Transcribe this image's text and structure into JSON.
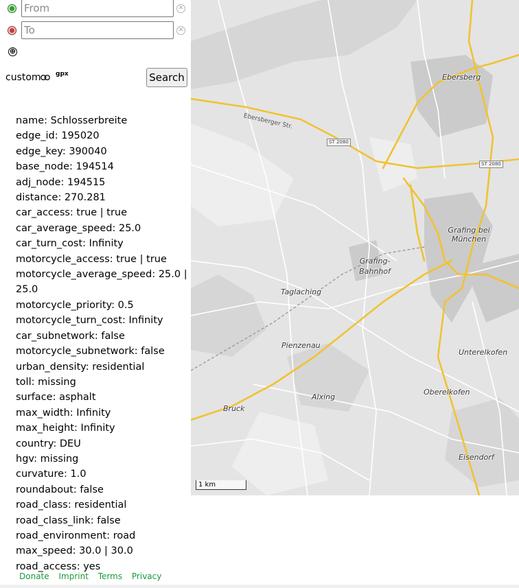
{
  "route": {
    "from_placeholder": "From",
    "to_placeholder": "To",
    "add_point_symbol": "⊕",
    "clear_symbol": "✕",
    "custom_label": "custom",
    "gpx_label": "gpx",
    "search_label": "Search"
  },
  "details": [
    "name: Schlosserbreite",
    "edge_id: 195020",
    "edge_key: 390040",
    "base_node: 194514",
    "adj_node: 194515",
    "distance: 270.281",
    "car_access: true | true",
    "car_average_speed: 25.0",
    "car_turn_cost: Infinity",
    "motorcycle_access: true | true",
    "motorcycle_average_speed: 25.0 | 25.0",
    "motorcycle_priority: 0.5",
    "motorcycle_turn_cost: Infinity",
    "car_subnetwork: false",
    "motorcycle_subnetwork: false",
    "urban_density: residential",
    "toll: missing",
    "surface: asphalt",
    "max_width: Infinity",
    "max_height: Infinity",
    "country: DEU",
    "hgv: missing",
    "curvature: 1.0",
    "roundabout: false",
    "road_class: residential",
    "road_class_link: false",
    "road_environment: road",
    "max_speed: 30.0 | 30.0",
    "road_access: yes"
  ],
  "footer": {
    "donate": "Donate",
    "imprint": "Imprint",
    "terms": "Terms",
    "privacy": "Privacy"
  },
  "map": {
    "places": {
      "ebersberg": "Ebersberg",
      "grafing_bei_muenchen": "Grafing bei München",
      "grafing_bahnhof": "Grafing-Bahnhof",
      "taglaching": "Taglaching",
      "pienzenau": "Pienzenau",
      "unterelkofen": "Unterelkofen",
      "oberelkofen": "Oberelkofen",
      "alxing": "Alxing",
      "bruck": "Bruck",
      "eisendorf": "Eisendorf"
    },
    "road_name": "Ebersberger Str.",
    "shield_1": "ST 2080",
    "shield_2": "ST 2080",
    "scale_label": "1 km",
    "colors": {
      "background": "#e4e4e4",
      "major_road": "#f1c232",
      "minor_road": "#ffffff",
      "town": "#cfcfcf",
      "forest": "#d8d8d8"
    }
  }
}
